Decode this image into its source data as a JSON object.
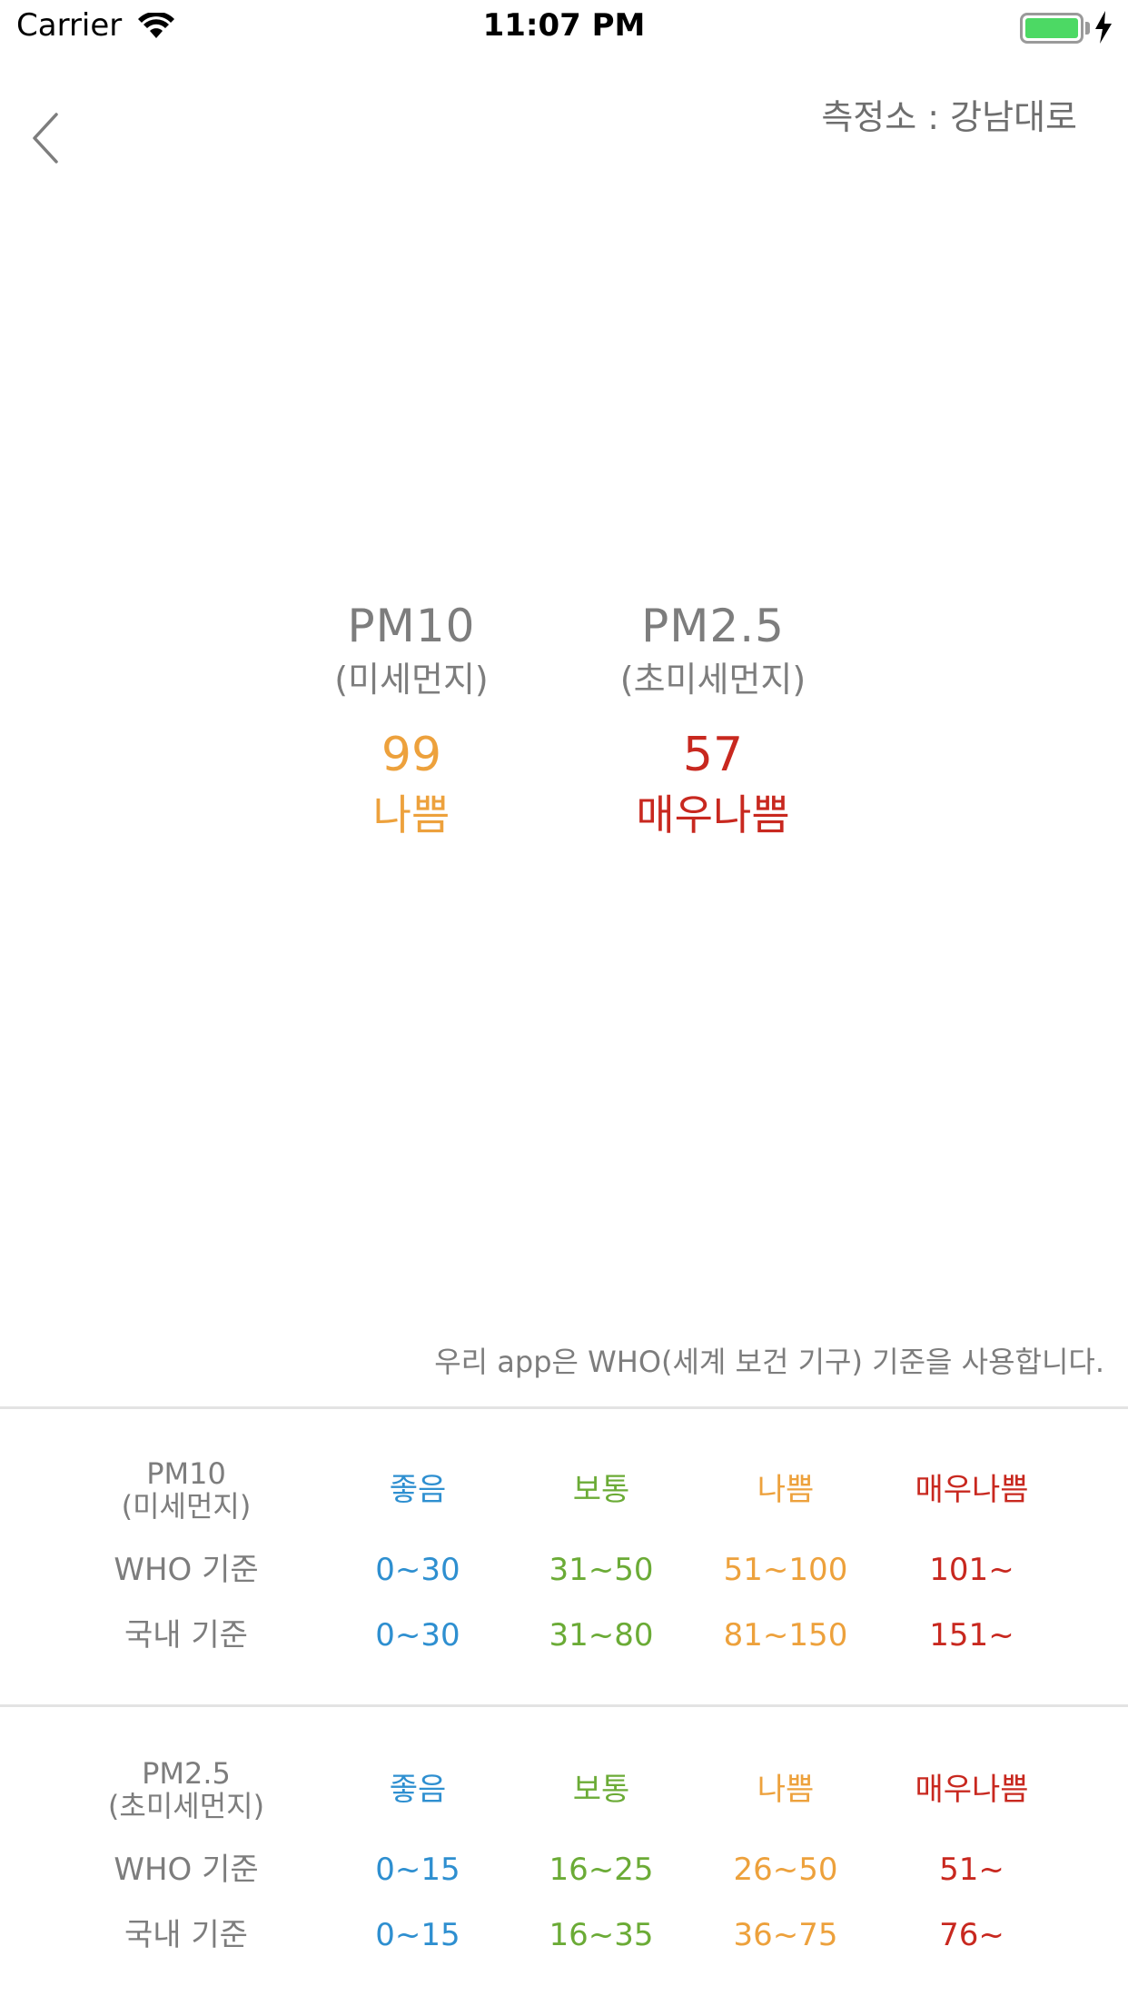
{
  "status_bar": {
    "carrier": "Carrier",
    "time": "11:07 PM",
    "battery_percent": 100
  },
  "nav": {
    "station": "측정소 : 강남대로"
  },
  "readings": {
    "pm10": {
      "name": "PM10",
      "sub": "(미세먼지)",
      "value": "99",
      "grade": "나쁨"
    },
    "pm25": {
      "name": "PM2.5",
      "sub": "(초미세먼지)",
      "value": "57",
      "grade": "매우나쁨"
    }
  },
  "notice": "우리 app은 WHO(세계 보건 기구) 기준을 사용합니다.",
  "colors": {
    "good": "#2e8fd0",
    "normal": "#6bab36",
    "bad": "#eda13c",
    "very_bad": "#c8281f",
    "text_gray": "#7d7d7d"
  },
  "tables": {
    "pm10": {
      "name": "PM10",
      "sub": "(미세먼지)",
      "grades": [
        "좋음",
        "보통",
        "나쁨",
        "매우나쁨"
      ],
      "who_label": "WHO 기준",
      "who": [
        "0~30",
        "31~50",
        "51~100",
        "101~"
      ],
      "domestic_label": "국내 기준",
      "domestic": [
        "0~30",
        "31~80",
        "81~150",
        "151~"
      ]
    },
    "pm25": {
      "name": "PM2.5",
      "sub": "(초미세먼지)",
      "grades": [
        "좋음",
        "보통",
        "나쁨",
        "매우나쁨"
      ],
      "who_label": "WHO 기준",
      "who": [
        "0~15",
        "16~25",
        "26~50",
        "51~"
      ],
      "domestic_label": "국내 기준",
      "domestic": [
        "0~15",
        "16~35",
        "36~75",
        "76~"
      ]
    }
  }
}
